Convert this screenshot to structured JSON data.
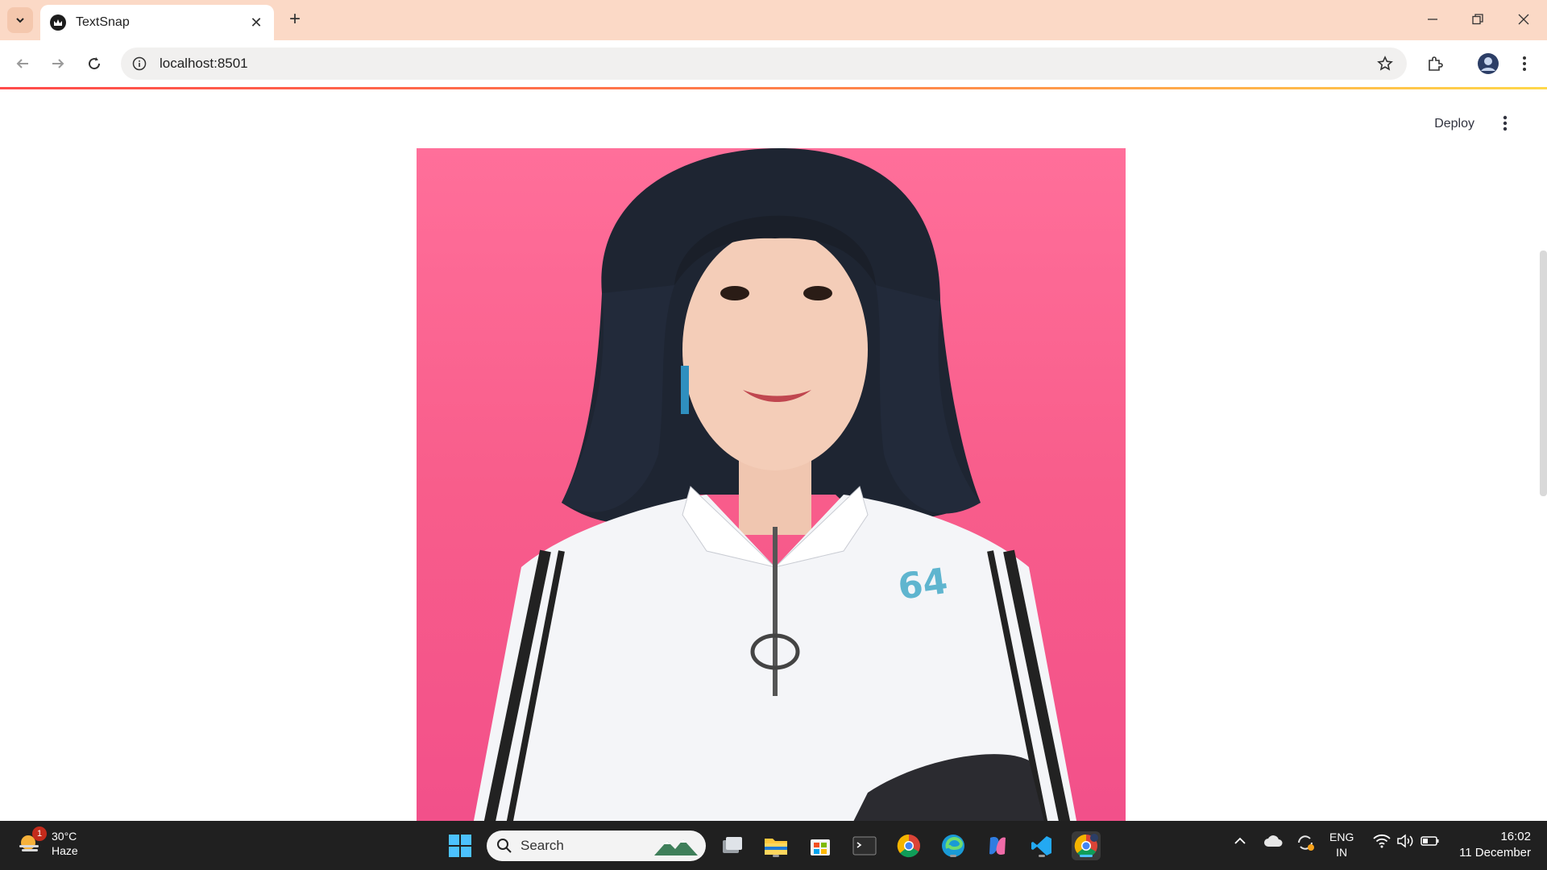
{
  "browser": {
    "tab_title": "TextSnap",
    "url": "localhost:8501"
  },
  "app": {
    "deploy_label": "Deploy"
  },
  "taskbar": {
    "weather_temp": "30°C",
    "weather_desc": "Haze",
    "weather_badge": "1",
    "search_label": "Search",
    "lang_line1": "ENG",
    "lang_line2": "IN",
    "time": "16:02",
    "date": "11 December"
  },
  "colors": {
    "tabstrip": "#fbd9c6",
    "photo_background": "#f85d8b",
    "taskbar": "#202020",
    "accent_progress": "#ff4b4b"
  }
}
